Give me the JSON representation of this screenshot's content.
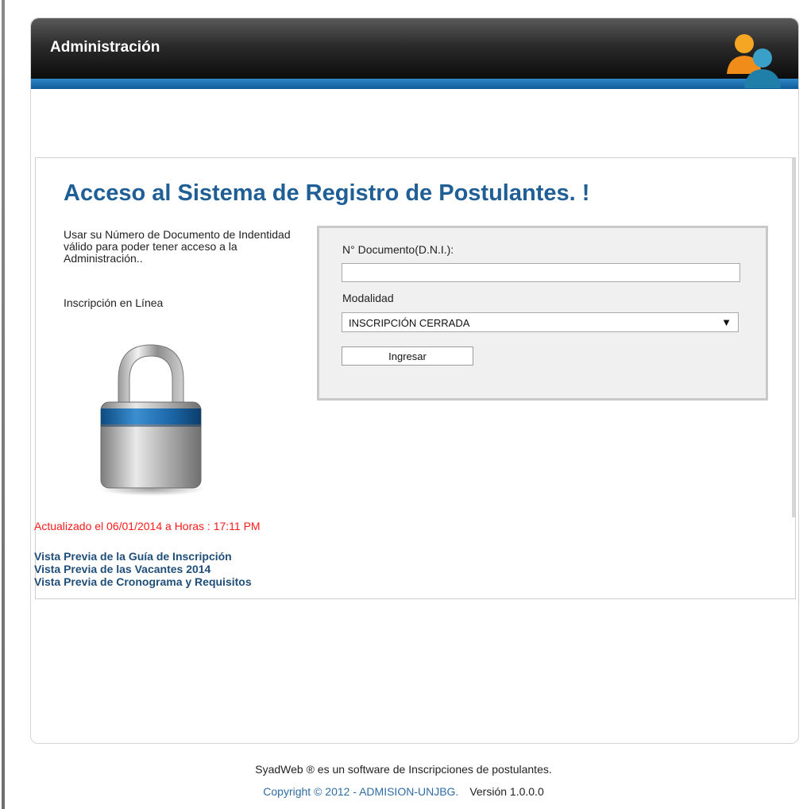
{
  "header": {
    "title": "Administración",
    "icon": "users-icon"
  },
  "main": {
    "heading": "Acceso al Sistema de Registro de Postulantes. !",
    "instructions": "Usar su Número de Documento de Indentidad válido para poder tener acceso a la Administración..",
    "online_label": "Inscripción en Línea",
    "lock_icon": "padlock-icon",
    "updated_text": "Actualizado el 06/01/2014 a Horas : 17:11 PM",
    "links": [
      "Vista Previa de la Guía de Inscripción",
      "Vista Previa de las Vacantes 2014",
      "Vista Previa de Cronograma y Requisitos"
    ]
  },
  "form": {
    "dni_label": "N° Documento(D.N.I.):",
    "dni_value": "",
    "modalidad_label": "Modalidad",
    "modalidad_selected": "INSCRIPCIÓN CERRADA",
    "submit_label": "Ingresar"
  },
  "footer": {
    "line1": "SyadWeb ® es un software de Inscripciones de postulantes.",
    "copyright": "Copyright © 2012 - ADMISION-UNJBG.",
    "version": "Versión 1.0.0.0"
  },
  "colors": {
    "accent": "#1f5f96",
    "stripe": "#1a6fb0",
    "update_red": "#ff1a1a",
    "link": "#1f4e79"
  }
}
